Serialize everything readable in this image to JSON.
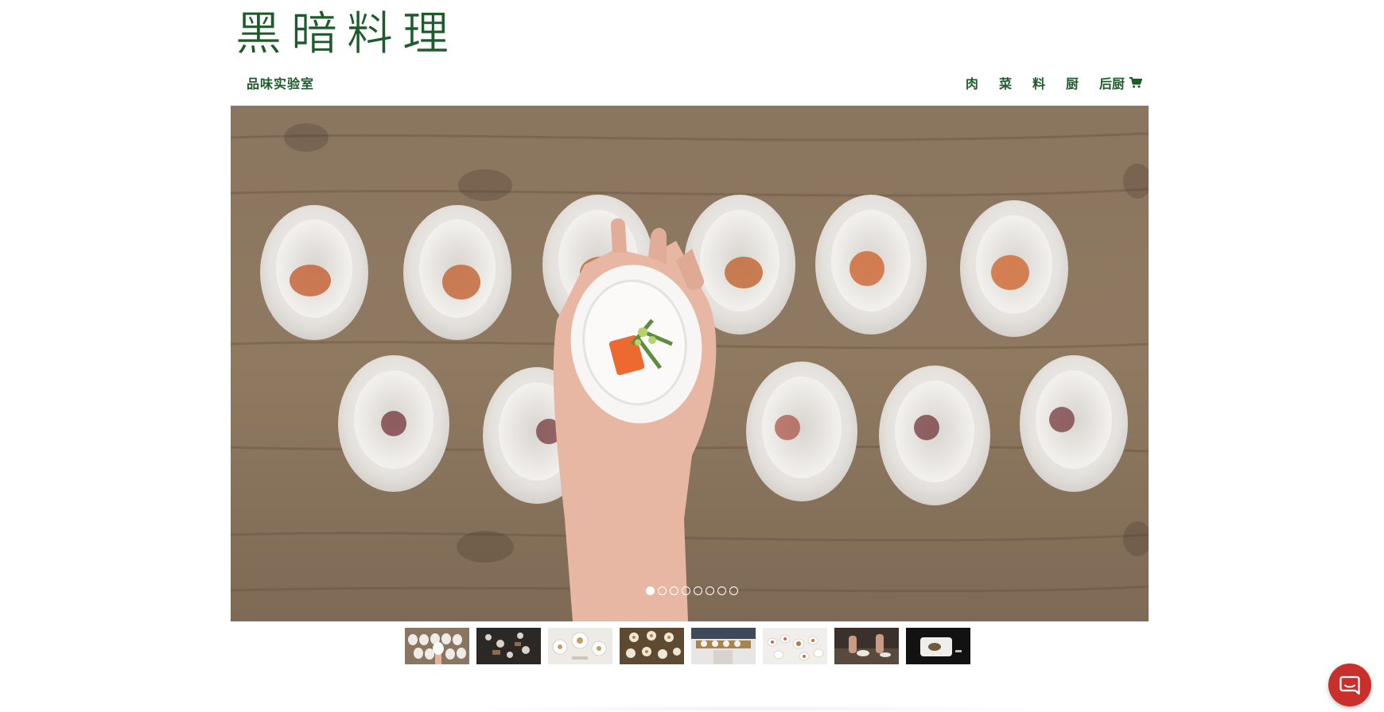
{
  "header": {
    "logo": "黑暗料理",
    "subtitle": "品味实验室",
    "nav": [
      {
        "label": "肉"
      },
      {
        "label": "菜"
      },
      {
        "label": "料"
      },
      {
        "label": "厨"
      },
      {
        "label": "后厨"
      }
    ],
    "cart_icon": "shopping-cart-icon"
  },
  "slider": {
    "total_slides": 8,
    "active_index": 0
  },
  "thumbnails": [
    {
      "name": "white-bowls-on-wood"
    },
    {
      "name": "dishes-on-dark-table"
    },
    {
      "name": "white-plates-spread"
    },
    {
      "name": "bowls-on-wood-tray"
    },
    {
      "name": "tray-held-by-person"
    },
    {
      "name": "small-plates-overview"
    },
    {
      "name": "hands-plating"
    },
    {
      "name": "plate-on-black"
    }
  ],
  "chat": {
    "icon": "chat-bubble-icon"
  },
  "colors": {
    "brand_green": "#1e5b2b",
    "chat_red": "#c9302c",
    "wood": "#8d765e"
  }
}
